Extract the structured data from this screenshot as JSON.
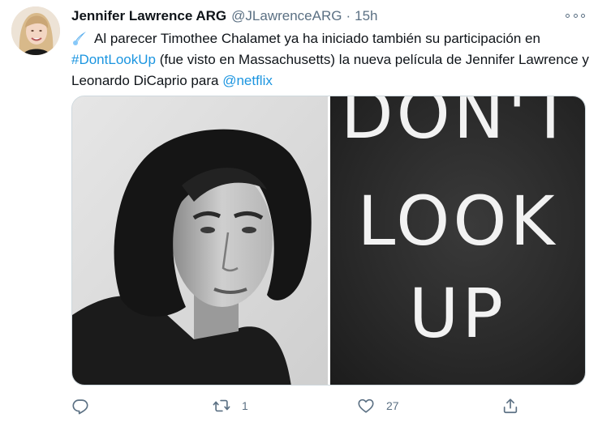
{
  "tweet": {
    "author": {
      "display_name": "Jennifer Lawrence ARG",
      "handle": "@JLawrenceARG",
      "separator": "·",
      "time": "15h"
    },
    "text": {
      "part1": "Al parecer Timothee Chalamet ya ha iniciado también su participación en",
      "hashtag": "#DontLookUp",
      "part2": "(fue visto en Massachusetts) la nueva película de Jennifer Lawrence y Leonardo DiCaprio para",
      "mention": "@netflix"
    },
    "media": {
      "right_poster_lines": [
        "DON'T",
        "LOOK",
        "UP"
      ]
    },
    "actions": {
      "reply_count": "",
      "retweet_count": "1",
      "like_count": "27"
    },
    "icons": {
      "comet": "comet-emoji-icon",
      "more": "more-options-icon",
      "reply": "reply-icon",
      "retweet": "retweet-icon",
      "like": "heart-icon",
      "share": "share-icon"
    },
    "colors": {
      "link": "#1b95e0",
      "secondary_text": "#5b7083",
      "primary_text": "#0f1419"
    }
  }
}
